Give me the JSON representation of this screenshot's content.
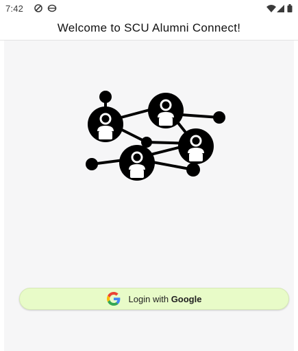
{
  "status_bar": {
    "time": "7:42",
    "left_icons": [
      "no-disturb-icon",
      "notification-icon"
    ],
    "right_icons": [
      "wifi-icon",
      "signal-icon",
      "battery-icon"
    ]
  },
  "appbar": {
    "title": "Welcome to SCU Alumni Connect!"
  },
  "main": {
    "logo": "alumni-network-logo",
    "login_button": {
      "prefix": "Login with ",
      "provider": "Google",
      "icon": "google-icon"
    }
  },
  "colors": {
    "button_bg": "#e8fbc8",
    "content_bg": "#f6f6f7",
    "logo": "#000000",
    "google_blue": "#4285F4",
    "google_red": "#EA4335",
    "google_yellow": "#FBBC05",
    "google_green": "#34A853"
  }
}
